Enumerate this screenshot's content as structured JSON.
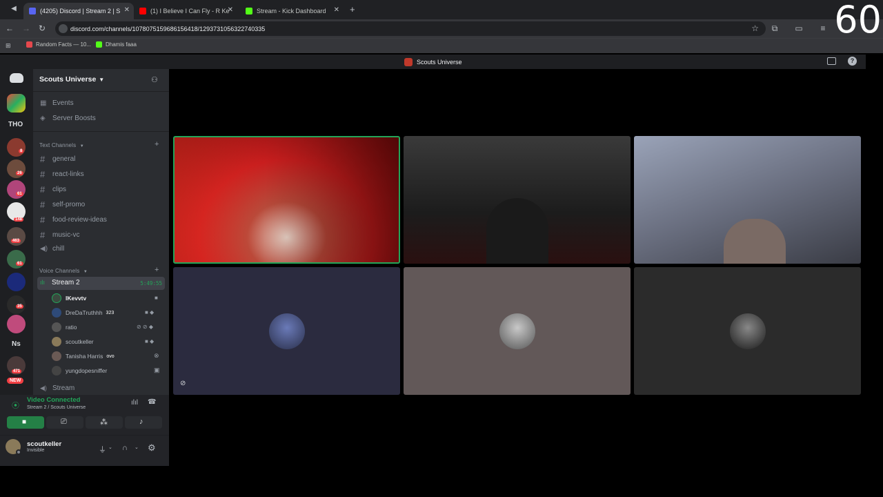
{
  "browser": {
    "tabs": [
      {
        "title": "(4205) Discord | Stream 2 | S",
        "color": "#5865f2"
      },
      {
        "title": "(1) I Believe I Can Fly - R Ke",
        "color": "#ff0000"
      },
      {
        "title": "Stream - Kick Dashboard",
        "color": "#53fc18"
      }
    ],
    "new_tab": "+",
    "url": "discord.com/channels/1078075159686156418/1293731056322740335",
    "bookmarks": [
      {
        "label": "Random Facts — 10..."
      },
      {
        "label": "Dhamis faaa"
      }
    ]
  },
  "overlay_counter": "60",
  "discord": {
    "window_title": "Scouts Universe",
    "server_name": "Scouts Universe",
    "guilds": [
      {
        "label": "THO"
      },
      {
        "badge": "8"
      },
      {
        "badge": "26"
      },
      {
        "badge": "61"
      },
      {
        "badge": "148"
      },
      {
        "badge": "463"
      },
      {
        "badge": "61"
      },
      {
        "badge": "35"
      },
      {
        "label": "Ns"
      },
      {
        "badge": "471"
      },
      {
        "badge": "NEW"
      }
    ],
    "top_items": [
      "Events",
      "Server Boosts"
    ],
    "text_category": "Text Channels",
    "text_channels": [
      "general",
      "react-links",
      "clips",
      "self-promo",
      "food-review-ideas",
      "music-vc",
      "chill"
    ],
    "voice_category": "Voice Channels",
    "voice_channel": {
      "name": "Stream 2",
      "timer": "5:49:55"
    },
    "members": [
      {
        "name": "lKevvtv",
        "extra": ""
      },
      {
        "name": "DreDaTruthhh",
        "extra": "323"
      },
      {
        "name": "ratio",
        "extra": ""
      },
      {
        "name": "scoutkeller",
        "extra": ""
      },
      {
        "name": "Tanisha Harris",
        "extra": "ovo"
      },
      {
        "name": "yungdopesniffer",
        "extra": ""
      }
    ],
    "next_channel": "Stream",
    "voice_panel": {
      "status": "Video Connected",
      "location": "Stream 2 / Scouts Universe"
    },
    "user": {
      "name": "scoutkeller",
      "status": "Invisible"
    }
  }
}
